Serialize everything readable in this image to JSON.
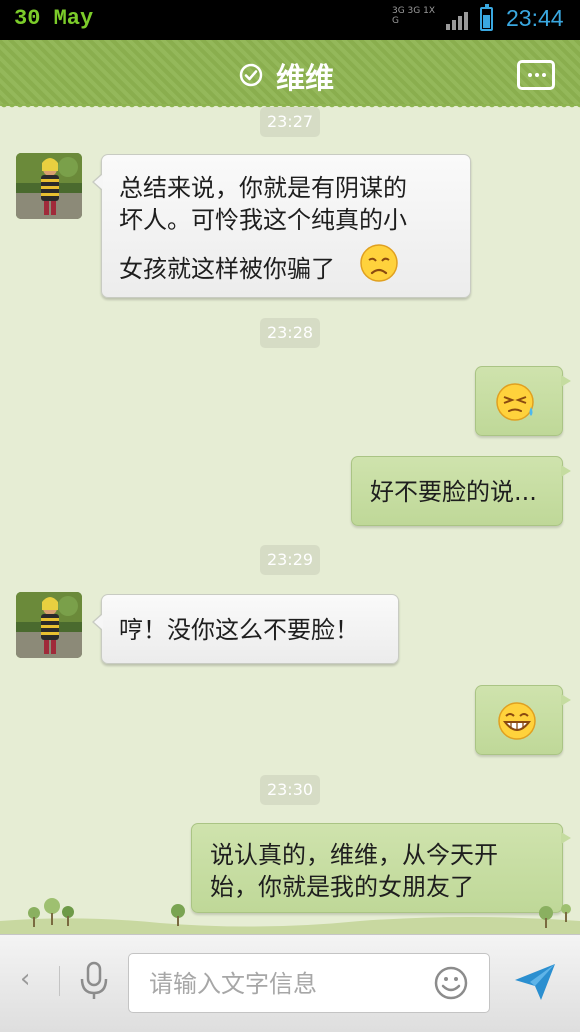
{
  "status_bar": {
    "date": "30 May",
    "network": "3G 3G 1X G",
    "time": "23:44",
    "battery_level": 0.72
  },
  "header": {
    "title": "维维",
    "verified_icon": "check-circle-icon",
    "menu_icon": "more-icon"
  },
  "conversation": {
    "timestamps": [
      "23:27",
      "23:28",
      "23:29",
      "23:30"
    ],
    "messages": [
      {
        "from": "them",
        "lines": [
          "总结来说，你就是有阴谋的",
          "坏人。可怜我这个纯真的小",
          "女孩就这样被你骗了"
        ],
        "emoji": "sad-face-emoji"
      },
      {
        "from": "me",
        "emoji": "sweat-face-emoji"
      },
      {
        "from": "me",
        "text": "好不要脸的说..."
      },
      {
        "from": "them",
        "text": "哼！没你这么不要脸！"
      },
      {
        "from": "me",
        "emoji": "grin-face-emoji"
      },
      {
        "from": "me",
        "lines": [
          "说认真的，维维，从今天开",
          "始，你就是我的女朋友了"
        ]
      }
    ]
  },
  "input_bar": {
    "back_icon": "chevron-left-icon",
    "voice_icon": "microphone-icon",
    "placeholder": "请输入文字信息",
    "emoji_icon": "smiley-icon",
    "send_icon": "send-icon"
  },
  "colors": {
    "header": "#8eb451",
    "background": "#e6edd4",
    "outgoing_bubble": "#c5dca0",
    "incoming_bubble": "#f4f4f4",
    "status_time": "#3aa8e0",
    "status_date": "#7ccc2a"
  }
}
